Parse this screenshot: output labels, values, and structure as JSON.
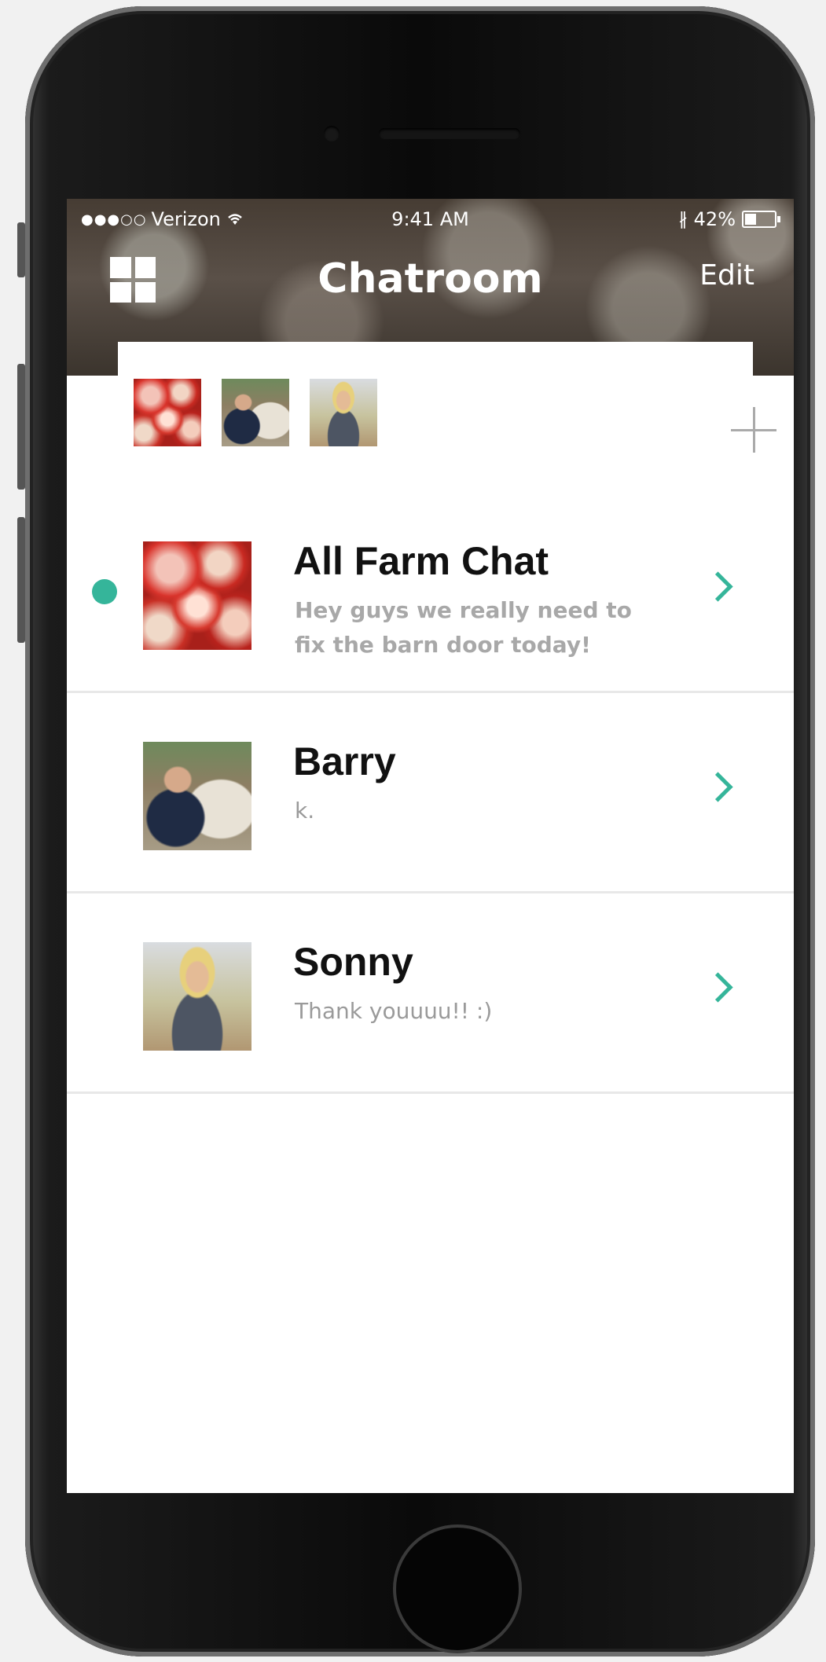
{
  "status_bar": {
    "signal": "●●●○○",
    "carrier": "Verizon",
    "wifi_icon": "wifi-icon",
    "time": "9:41 AM",
    "bluetooth": "∦",
    "battery": "42%",
    "battery_level": 0.42
  },
  "nav": {
    "menu_icon": "grid-icon",
    "title": "Chatroom",
    "edit_label": "Edit"
  },
  "recent": {
    "avatars": [
      "apples",
      "farmer",
      "woman"
    ],
    "add_icon": "plus-icon"
  },
  "chats": [
    {
      "name": "All Farm Chat",
      "preview": "Hey guys we really need to fix the barn door today!",
      "unread": true
    },
    {
      "name": "Barry",
      "preview": "k.",
      "unread": false
    },
    {
      "name": "Sonny",
      "preview": "Thank youuuu!! :)",
      "unread": false
    }
  ],
  "colors": {
    "accent": "#35b59a",
    "header_overlay": "#463c33"
  }
}
